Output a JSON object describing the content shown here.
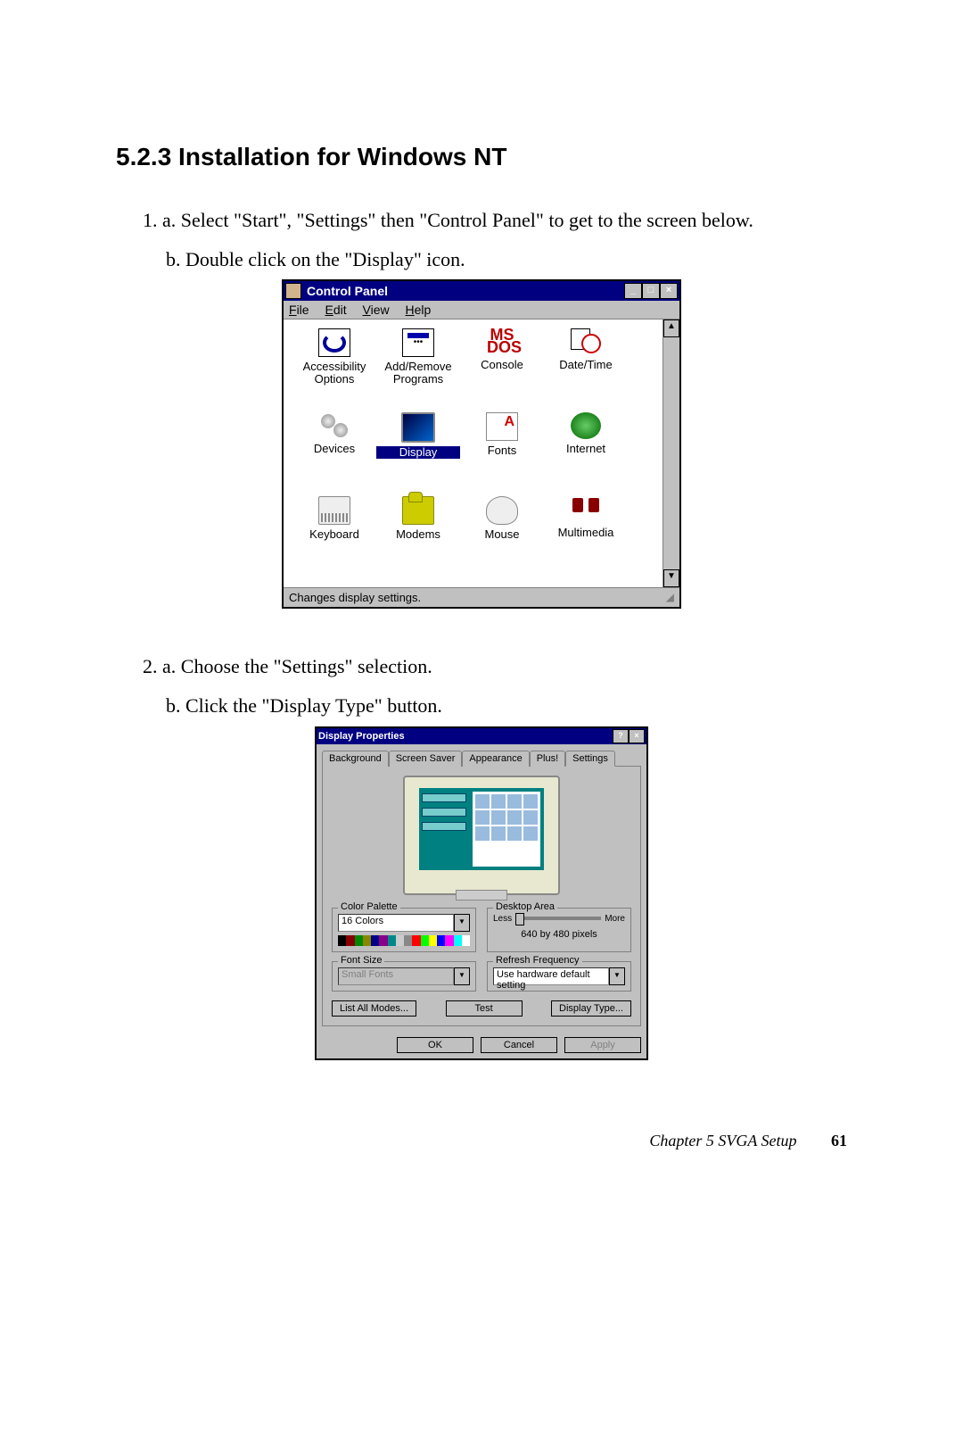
{
  "heading": "5.2.3 Installation for Windows NT",
  "step1a": "1.  a. Select \"Start\", \"Settings\" then \"Control Panel\" to get to the screen below.",
  "step1b": "b. Double click on the \"Display\" icon.",
  "step2a": "2.  a. Choose the \"Settings\" selection.",
  "step2b": "b. Click the \"Display Type\" button.",
  "cp": {
    "title": "Control Panel",
    "menu": {
      "file": "File",
      "edit": "Edit",
      "view": "View",
      "help": "Help"
    },
    "icons": [
      {
        "label": "Accessibility Options",
        "k": "access"
      },
      {
        "label": "Add/Remove Programs",
        "k": "addrem"
      },
      {
        "label": "Console",
        "k": "console"
      },
      {
        "label": "Date/Time",
        "k": "date"
      },
      {
        "label": "Devices",
        "k": "devices"
      },
      {
        "label": "Display",
        "k": "display",
        "selected": true
      },
      {
        "label": "Fonts",
        "k": "fonts"
      },
      {
        "label": "Internet",
        "k": "internet"
      },
      {
        "label": "Keyboard",
        "k": "kbd"
      },
      {
        "label": "Modems",
        "k": "modem"
      },
      {
        "label": "Mouse",
        "k": "mouse"
      },
      {
        "label": "Multimedia",
        "k": "multi"
      }
    ],
    "status": "Changes display settings.",
    "consoleText": "MS DOS"
  },
  "dp": {
    "title": "Display Properties",
    "tabs": [
      "Background",
      "Screen Saver",
      "Appearance",
      "Plus!",
      "Settings"
    ],
    "activeTab": 4,
    "colorPalette": {
      "label": "Color Palette",
      "value": "16 Colors"
    },
    "desktopArea": {
      "label": "Desktop Area",
      "less": "Less",
      "more": "More",
      "value": "640 by 480 pixels"
    },
    "fontSize": {
      "label": "Font Size",
      "value": "Small Fonts"
    },
    "refresh": {
      "label": "Refresh Frequency",
      "value": "Use hardware default setting"
    },
    "buttons": {
      "listModes": "List All Modes...",
      "test": "Test",
      "displayType": "Display Type..."
    },
    "dlg": {
      "ok": "OK",
      "cancel": "Cancel",
      "apply": "Apply"
    }
  },
  "footer": {
    "chapter": "Chapter 5  SVGA Setup",
    "page": "61"
  }
}
